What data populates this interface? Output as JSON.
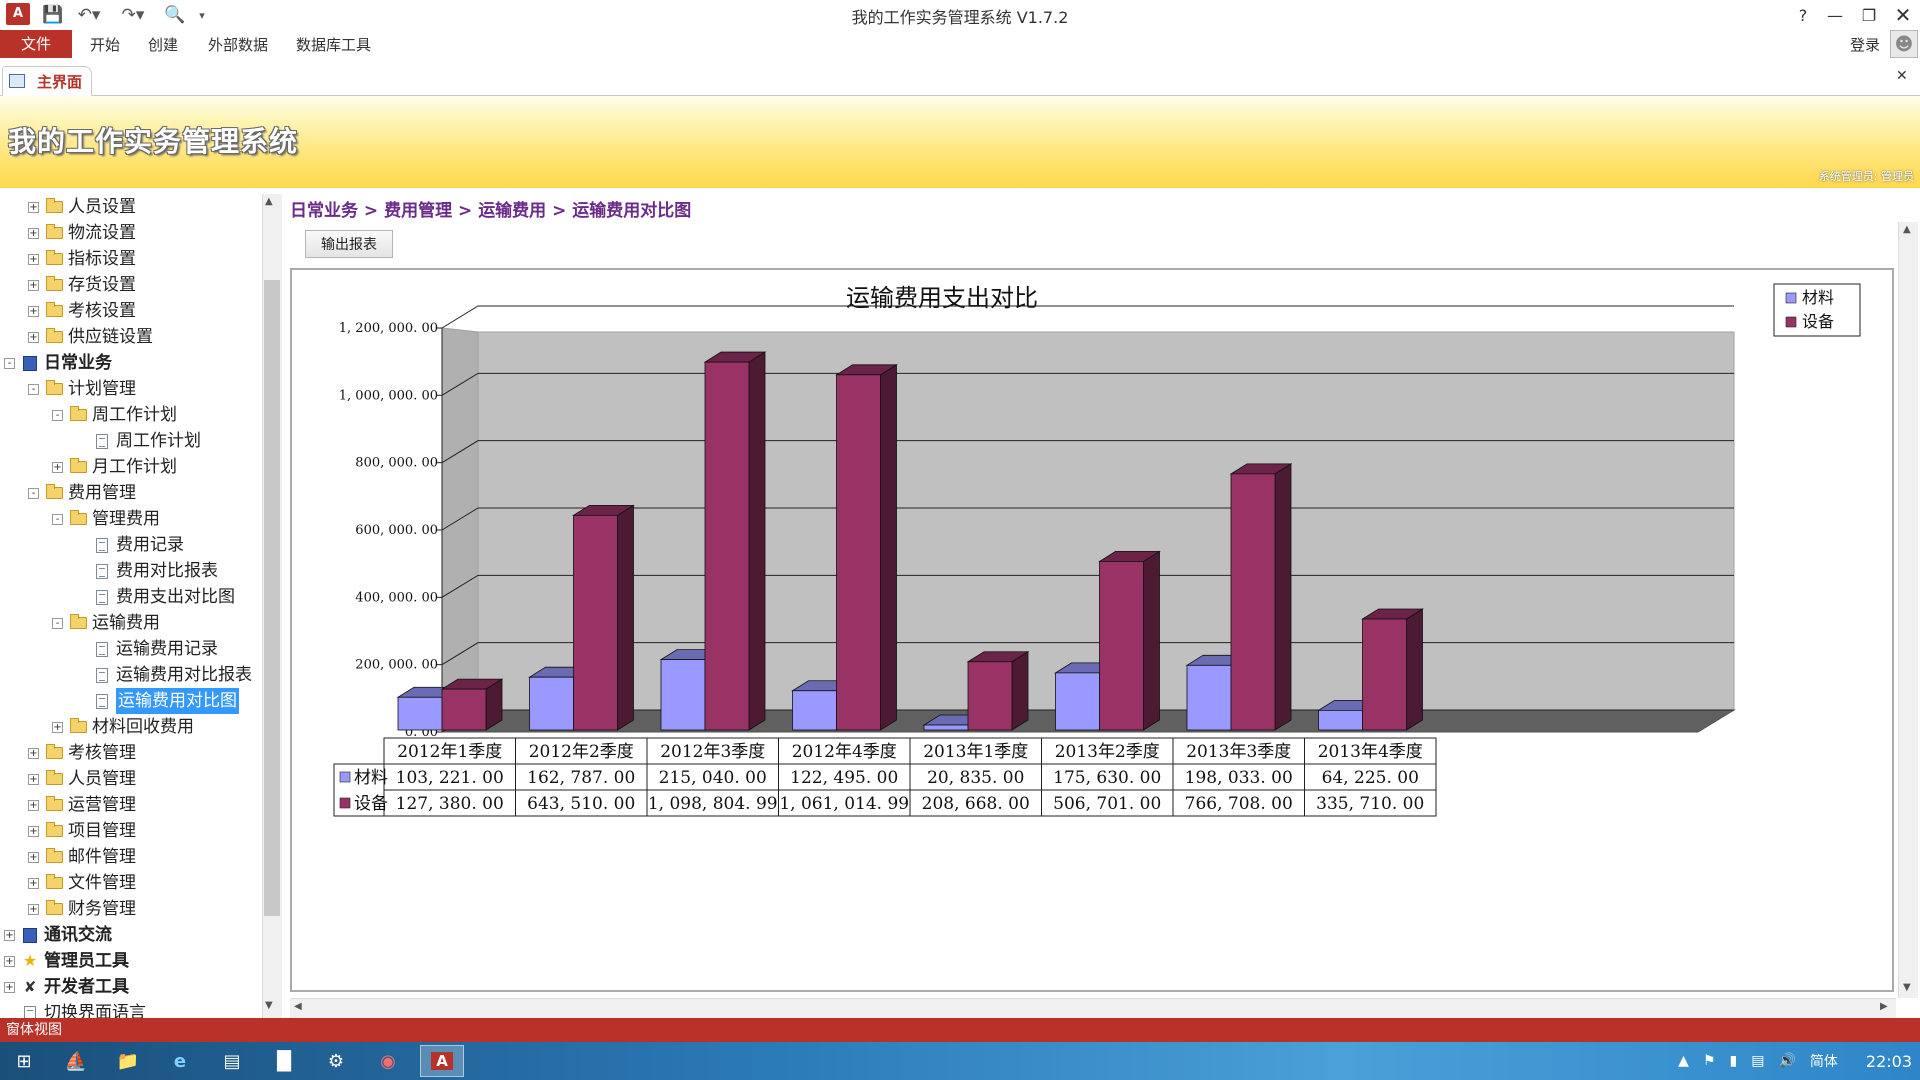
{
  "window": {
    "title": "我的工作实务管理系统 V1.7.2",
    "login": "登录",
    "help": "?"
  },
  "ribbon": {
    "file": "文件",
    "tabs": [
      "开始",
      "创建",
      "外部数据",
      "数据库工具"
    ]
  },
  "doc_tab": {
    "label": "主界面"
  },
  "banner": {
    "title": "我的工作实务管理系统",
    "user": "系统管理员: 管理员"
  },
  "breadcrumb": [
    "日常业务",
    "费用管理",
    "运输费用",
    "运输费用对比图"
  ],
  "breadcrumb_sep": ">",
  "export_button": "输出报表",
  "tree": [
    {
      "label": "人员设置",
      "level": 1,
      "type": "folder",
      "exp": "+"
    },
    {
      "label": "物流设置",
      "level": 1,
      "type": "folder",
      "exp": "+"
    },
    {
      "label": "指标设置",
      "level": 1,
      "type": "folder",
      "exp": "+"
    },
    {
      "label": "存货设置",
      "level": 1,
      "type": "folder",
      "exp": "+"
    },
    {
      "label": "考核设置",
      "level": 1,
      "type": "folder",
      "exp": "+"
    },
    {
      "label": "供应链设置",
      "level": 1,
      "type": "folder",
      "exp": "+"
    },
    {
      "label": "日常业务",
      "level": 0,
      "type": "book",
      "exp": "-",
      "bold": true
    },
    {
      "label": "计划管理",
      "level": 1,
      "type": "folder",
      "exp": "-"
    },
    {
      "label": "周工作计划",
      "level": 2,
      "type": "folder",
      "exp": "-"
    },
    {
      "label": "周工作计划",
      "level": 3,
      "type": "doc"
    },
    {
      "label": "月工作计划",
      "level": 2,
      "type": "folder",
      "exp": "+"
    },
    {
      "label": "费用管理",
      "level": 1,
      "type": "folder",
      "exp": "-"
    },
    {
      "label": "管理费用",
      "level": 2,
      "type": "folder",
      "exp": "-"
    },
    {
      "label": "费用记录",
      "level": 3,
      "type": "doc"
    },
    {
      "label": "费用对比报表",
      "level": 3,
      "type": "doc"
    },
    {
      "label": "费用支出对比图",
      "level": 3,
      "type": "doc"
    },
    {
      "label": "运输费用",
      "level": 2,
      "type": "folder",
      "exp": "-"
    },
    {
      "label": "运输费用记录",
      "level": 3,
      "type": "doc"
    },
    {
      "label": "运输费用对比报表",
      "level": 3,
      "type": "doc"
    },
    {
      "label": "运输费用对比图",
      "level": 3,
      "type": "doc",
      "selected": true
    },
    {
      "label": "材料回收费用",
      "level": 2,
      "type": "folder",
      "exp": "+"
    },
    {
      "label": "考核管理",
      "level": 1,
      "type": "folder",
      "exp": "+"
    },
    {
      "label": "人员管理",
      "level": 1,
      "type": "folder",
      "exp": "+"
    },
    {
      "label": "运营管理",
      "level": 1,
      "type": "folder",
      "exp": "+"
    },
    {
      "label": "项目管理",
      "level": 1,
      "type": "folder",
      "exp": "+"
    },
    {
      "label": "邮件管理",
      "level": 1,
      "type": "folder",
      "exp": "+"
    },
    {
      "label": "文件管理",
      "level": 1,
      "type": "folder",
      "exp": "+"
    },
    {
      "label": "财务管理",
      "level": 1,
      "type": "folder",
      "exp": "+"
    },
    {
      "label": "通讯交流",
      "level": 0,
      "type": "book",
      "exp": "+",
      "bold": true
    },
    {
      "label": "管理员工具",
      "level": 0,
      "type": "star",
      "exp": "+",
      "bold": true
    },
    {
      "label": "开发者工具",
      "level": 0,
      "type": "tools",
      "exp": "+",
      "bold": true
    },
    {
      "label": "切换界面语言",
      "level": 0,
      "type": "doc"
    }
  ],
  "status": "窗体视图",
  "tray": {
    "ime": "简体",
    "time": "22:03"
  },
  "chart_data": {
    "type": "bar",
    "title": "运输费用支出对比",
    "categories": [
      "2012年1季度",
      "2012年2季度",
      "2012年3季度",
      "2012年4季度",
      "2013年1季度",
      "2013年2季度",
      "2013年3季度",
      "2013年4季度"
    ],
    "series": [
      {
        "name": "材料",
        "color": "#9999ff",
        "values": [
          103221.0,
          162787.0,
          215040.0,
          122495.0,
          20835.0,
          175630.0,
          198033.0,
          64225.0
        ],
        "labels": [
          "103, 221. 00",
          "162, 787. 00",
          "215, 040. 00",
          "122, 495. 00",
          "20, 835. 00",
          "175, 630. 00",
          "198, 033. 00",
          "64, 225. 00"
        ]
      },
      {
        "name": "设备",
        "color": "#993366",
        "values": [
          127380.0,
          643510.0,
          1098804.99,
          1061014.99,
          208668.0,
          506701.0,
          766708.0,
          335710.0
        ],
        "labels": [
          "127, 380. 00",
          "643, 510. 00",
          "1, 098, 804. 99",
          "1, 061, 014. 99",
          "208, 668. 00",
          "506, 701. 00",
          "766, 708. 00",
          "335, 710. 00"
        ]
      }
    ],
    "ylim": [
      0,
      1200000
    ],
    "yticks": [
      0,
      200000,
      400000,
      600000,
      800000,
      1000000,
      1200000
    ],
    "ytick_labels": [
      "0. 00",
      "200, 000. 00",
      "400, 000. 00",
      "600, 000. 00",
      "800, 000. 00",
      "1, 000, 000. 00",
      "1, 200, 000. 00"
    ],
    "legend": "top-right",
    "grid": true,
    "style": "3d"
  }
}
